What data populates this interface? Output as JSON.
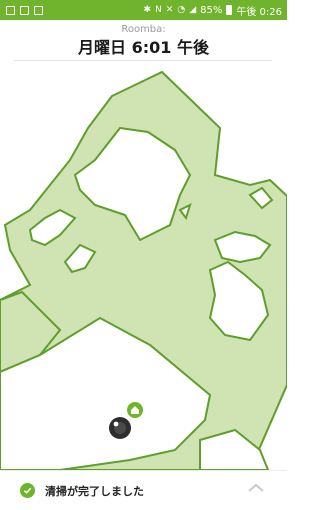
{
  "status_bar": {
    "battery": "85%",
    "time": "午後 0:26"
  },
  "header": {
    "device_name": "Roomba:",
    "session_time": "月曜日 6:01 午後"
  },
  "footer": {
    "status_text": "清掃が完了しました"
  },
  "colors": {
    "accent": "#6fb42c",
    "map_fill": "#cfe3b3",
    "map_edge": "#5f9e2a"
  },
  "icons": {
    "dock": "home-icon",
    "robot": "roomba-icon",
    "complete": "check-circle-icon",
    "expand": "chevron-up-icon"
  }
}
